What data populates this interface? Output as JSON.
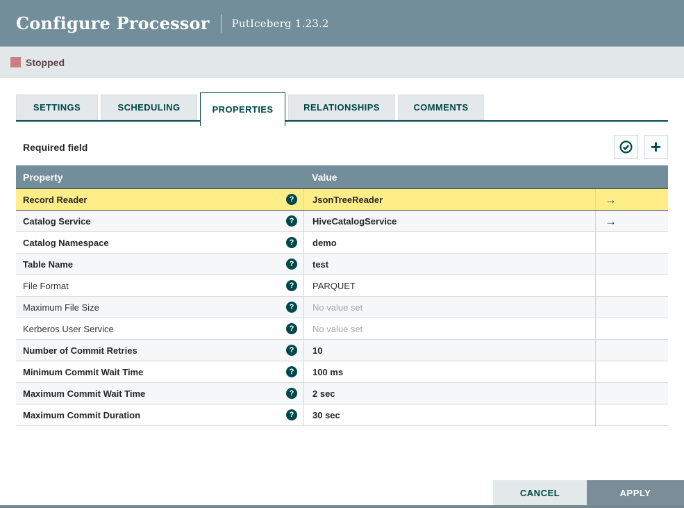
{
  "dialog": {
    "title": "Configure Processor",
    "subtitle": "PutIceberg 1.23.2"
  },
  "status": {
    "label": "Stopped",
    "color": "#ca8080"
  },
  "tabs": [
    {
      "label": "SETTINGS",
      "active": false
    },
    {
      "label": "SCHEDULING",
      "active": false
    },
    {
      "label": "PROPERTIES",
      "active": true
    },
    {
      "label": "RELATIONSHIPS",
      "active": false
    },
    {
      "label": "COMMENTS",
      "active": false
    }
  ],
  "toolbar": {
    "required_field_label": "Required field",
    "actions": [
      {
        "icon": "verify-properties-icon"
      },
      {
        "icon": "add-property-icon"
      }
    ]
  },
  "table": {
    "columns": {
      "property": "Property",
      "value": "Value"
    },
    "rows": [
      {
        "property": "Record Reader",
        "value": "JsonTreeReader",
        "required": true,
        "selected": true,
        "unset": false,
        "goto": true
      },
      {
        "property": "Catalog Service",
        "value": "HiveCatalogService",
        "required": true,
        "selected": false,
        "unset": false,
        "goto": true
      },
      {
        "property": "Catalog Namespace",
        "value": "demo",
        "required": true,
        "selected": false,
        "unset": false,
        "goto": false
      },
      {
        "property": "Table Name",
        "value": "test",
        "required": true,
        "selected": false,
        "unset": false,
        "goto": false
      },
      {
        "property": "File Format",
        "value": "PARQUET",
        "required": false,
        "selected": false,
        "unset": false,
        "goto": false
      },
      {
        "property": "Maximum File Size",
        "value": "No value set",
        "required": false,
        "selected": false,
        "unset": true,
        "goto": false
      },
      {
        "property": "Kerberos User Service",
        "value": "No value set",
        "required": false,
        "selected": false,
        "unset": true,
        "goto": false
      },
      {
        "property": "Number of Commit Retries",
        "value": "10",
        "required": true,
        "selected": false,
        "unset": false,
        "goto": false
      },
      {
        "property": "Minimum Commit Wait Time",
        "value": "100 ms",
        "required": true,
        "selected": false,
        "unset": false,
        "goto": false
      },
      {
        "property": "Maximum Commit Wait Time",
        "value": "2 sec",
        "required": true,
        "selected": false,
        "unset": false,
        "goto": false
      },
      {
        "property": "Maximum Commit Duration",
        "value": "30 sec",
        "required": true,
        "selected": false,
        "unset": false,
        "goto": false
      }
    ]
  },
  "footer": {
    "cancel_label": "CANCEL",
    "apply_label": "APPLY"
  },
  "colors": {
    "header_bg": "#728e9b",
    "accent_teal": "#004849",
    "selected_row_bg": "#ffee87",
    "status_bar_bg": "#e2e7ea",
    "stopped_square": "#ca8080",
    "apply_button_bg": "#7a8e99"
  }
}
